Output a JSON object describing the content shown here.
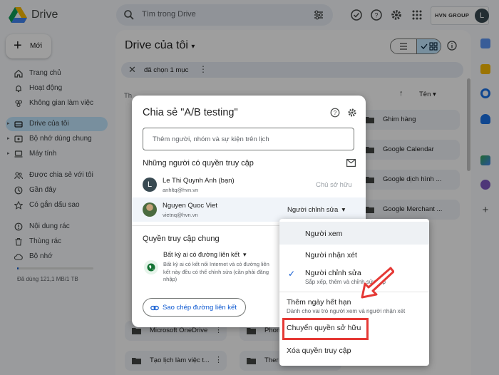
{
  "app": {
    "brand": "Drive"
  },
  "search": {
    "placeholder": "Tìm trong Drive"
  },
  "header": {
    "company": "HVN GROUP",
    "avatar_letter": "L"
  },
  "sidebar": {
    "new_label": "Mới",
    "items": [
      {
        "label": "Trang chủ",
        "icon": "home-icon"
      },
      {
        "label": "Hoạt động",
        "icon": "bell-icon"
      },
      {
        "label": "Không gian làm việc",
        "icon": "workspace-icon"
      },
      {
        "label": "Drive của tôi",
        "icon": "drive-icon",
        "active": true
      },
      {
        "label": "Bộ nhớ dùng chung",
        "icon": "shared-drive-icon"
      },
      {
        "label": "Máy tính",
        "icon": "computer-icon"
      },
      {
        "label": "Được chia sẻ với tôi",
        "icon": "people-icon"
      },
      {
        "label": "Gần đây",
        "icon": "clock-icon"
      },
      {
        "label": "Có gắn dấu sao",
        "icon": "star-icon"
      },
      {
        "label": "Nội dung rác",
        "icon": "spam-icon"
      },
      {
        "label": "Thùng rác",
        "icon": "trash-icon"
      },
      {
        "label": "Bộ nhớ",
        "icon": "cloud-icon"
      }
    ],
    "storage_text": "Đã dùng 121,1 MB/1 TB",
    "storage_fraction": 0.01
  },
  "main": {
    "title": "Drive của tôi",
    "selection_text": "đã chọn 1 mục",
    "sort_label": "Tên",
    "quick_label": "Th",
    "folders_right": [
      "Ghim hàng",
      "Google Calendar",
      "Google dịch hình ...",
      "Google Merchant ..."
    ],
    "folders_bottom": [
      "Microsoft OneDrive",
      "Phon",
      "Tạo lịch làm việc t...",
      "Ther"
    ]
  },
  "share_dialog": {
    "title": "Chia sẻ \"A/B testing\"",
    "input_placeholder": "Thêm người, nhóm và sự kiện trên lịch",
    "people_section": "Những người có quyền truy cập",
    "people": [
      {
        "name": "Le Thi Quynh Anh (bạn)",
        "email": "anhltq@hvn.vn",
        "role": "Chủ sở hữu",
        "avatar_letter": "L"
      },
      {
        "name": "Nguyen Quoc Viet",
        "email": "vietnq@hvn.vn",
        "role": "Người chỉnh sửa"
      }
    ],
    "general_section": "Quyền truy cập chung",
    "general_selected": "Bất kỳ ai có đường liên kết",
    "general_desc": "Bất kỳ ai có kết nối Internet và có đường liên kết này đều có thể chỉnh sửa (cần phải đăng nhập)",
    "copy_link": "Sao chép đường liên kết"
  },
  "role_menu": {
    "items": [
      {
        "label": "Người xem"
      },
      {
        "label": "Người nhận xét"
      },
      {
        "label": "Người chỉnh sửa",
        "sub": "Sắp xếp, thêm và chỉnh sửa tệp",
        "checked": true
      }
    ],
    "extra": [
      {
        "label": "Thêm ngày hết hạn",
        "sub": "Dành cho vai trò người xem và người nhận xét"
      },
      {
        "label": "Chuyển quyền sở hữu",
        "highlighted": true
      },
      {
        "label": "Xóa quyền truy cập"
      }
    ]
  },
  "colors": {
    "accent": "#0b57d0",
    "active_nav": "#c2e7ff",
    "annotation": "#e53935"
  }
}
